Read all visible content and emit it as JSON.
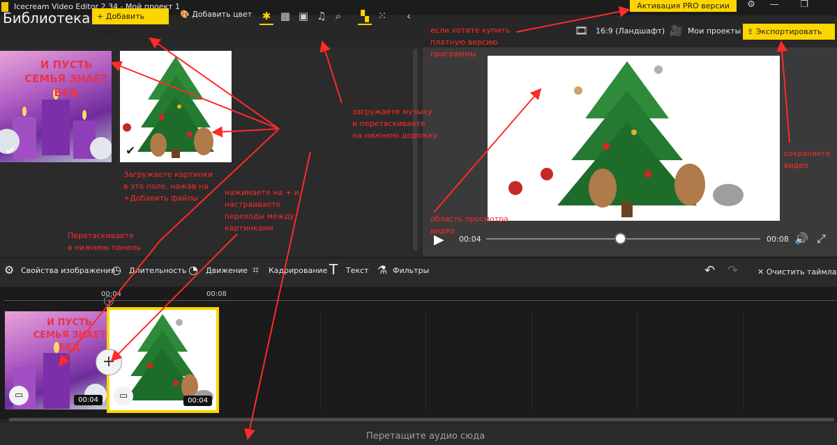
{
  "window": {
    "title": "Icecream Video Editor 2.34 - Мой проект 1",
    "pro_button": "Активация PRO версии",
    "settings_icon": "gear-icon",
    "minimize_glyph": "—",
    "restore_glyph": "❐"
  },
  "library": {
    "title": "Библиотека",
    "add_files_label": "Добавить файлы",
    "add_color_label": "Добавить цвет",
    "filter_icons": [
      "star-icon",
      "film-icon",
      "image-icon",
      "music-icon",
      "search-icon"
    ],
    "view_icons": [
      "grid-large-icon",
      "grid-small-icon"
    ],
    "collapse_icon": "chevron-left-icon",
    "items": [
      {
        "name": "candles",
        "overlay_text": "И ПУСТЬ СЕМЬЯ ЗНАЕТ БЕД"
      },
      {
        "name": "christmas-tree",
        "overlay_text": ""
      }
    ]
  },
  "preview": {
    "aspect_label": "16:9 (Ландшафт)",
    "projects_label": "Мои проекты",
    "export_label": "Экспортировать видео",
    "current_time": "00:04",
    "total_time": "00:08",
    "progress": 0.49
  },
  "edit_toolbar": {
    "items": [
      {
        "label": "Свойства изображения",
        "icon": "gear-icon"
      },
      {
        "label": "Длительность",
        "icon": "clock-icon"
      },
      {
        "label": "Движение",
        "icon": "motion-icon"
      },
      {
        "label": "Кадрирование",
        "icon": "crop-icon"
      },
      {
        "label": "Текст",
        "icon": "text-icon"
      },
      {
        "label": "Фильтры",
        "icon": "filter-icon"
      }
    ],
    "clear_label": "Очистить таймлайн"
  },
  "timeline": {
    "ruler": [
      "00:04",
      "00:08"
    ],
    "clips": [
      {
        "name": "candles",
        "duration": "00:04"
      },
      {
        "name": "christmas-tree",
        "duration": "00:04",
        "selected": true
      }
    ],
    "audio_hint": "Перетащите аудио сюда"
  },
  "annotations": {
    "buy_pro": "если хотите купить\nплатную версию\nпрограммы",
    "music": "загружаете музыку\nи перетаскиваете\nна нижнюю дорожку",
    "export": "сохраняете\nвидео",
    "pictures": "Загружаете картинки\nв это поле, нажав на\n+Добавить файлы",
    "transitions": "нажимаете на + и\nнастраиваете\nпереходы между\nкартинками",
    "drag": "Перетаскиваете\nв нижнюю панель",
    "preview": "область просмотра\nвидео",
    "color": "#ff2a2a"
  }
}
